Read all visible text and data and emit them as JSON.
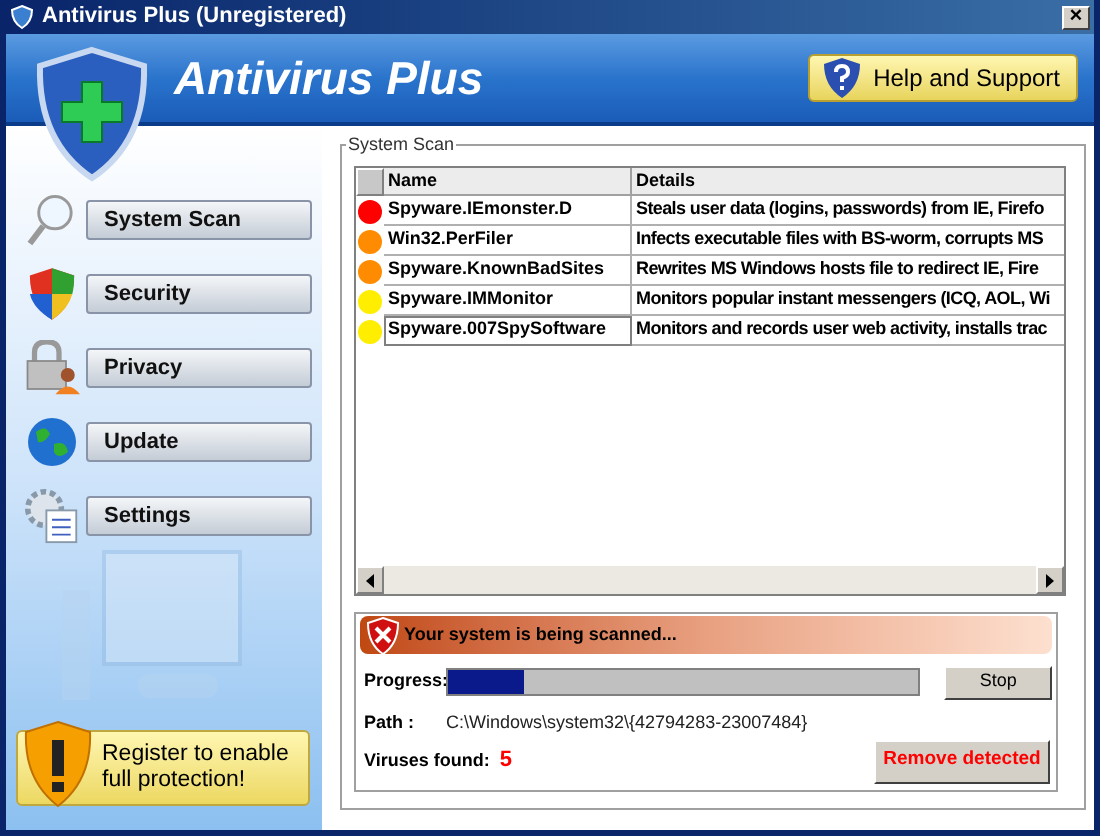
{
  "window": {
    "title": "Antivirus Plus (Unregistered)",
    "close": "×"
  },
  "header": {
    "title": "Antivirus Plus",
    "help_button": "Help and Support"
  },
  "sidebar": {
    "items": [
      {
        "label": "System Scan",
        "kind": "scan"
      },
      {
        "label": "Security",
        "kind": "security"
      },
      {
        "label": "Privacy",
        "kind": "privacy"
      },
      {
        "label": "Update",
        "kind": "update"
      },
      {
        "label": "Settings",
        "kind": "settings"
      }
    ],
    "register": "Register to enable full protection!"
  },
  "scan": {
    "group_title": "System Scan",
    "table": {
      "columns": [
        "Name",
        "Details"
      ],
      "rows": [
        {
          "color": "#ff0000",
          "name": "Spyware.IEmonster.D",
          "details": "Steals user data (logins, passwords) from IE, Firefo",
          "selected": false
        },
        {
          "color": "#ff8c00",
          "name": "Win32.PerFiler",
          "details": "Infects executable files with BS-worm, corrupts MS",
          "selected": false
        },
        {
          "color": "#ff8c00",
          "name": "Spyware.KnownBadSites",
          "details": "Rewrites MS Windows hosts file to redirect IE, Fire",
          "selected": false
        },
        {
          "color": "#ffee00",
          "name": "Spyware.IMMonitor",
          "details": "Monitors popular instant messengers (ICQ, AOL, Wi",
          "selected": false
        },
        {
          "color": "#ffee00",
          "name": "Spyware.007SpySoftware",
          "details": "Monitors and records user web activity, installs trac",
          "selected": true
        }
      ]
    },
    "status": "Your system is being scanned...",
    "progress_label": "Progress:",
    "progress": {
      "level": 0.16
    },
    "stop_button": "Stop",
    "path_label": "Path :",
    "path": "C:\\Windows\\system32\\{42794283-23007484}",
    "viruses_label": "Viruses found:",
    "viruses_count": "5",
    "remove_button": "Remove detected"
  }
}
